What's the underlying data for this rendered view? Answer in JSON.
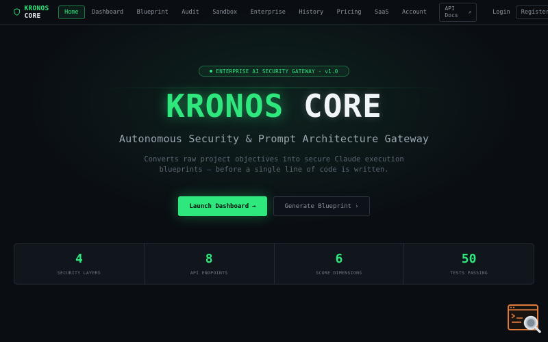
{
  "nav": {
    "brand_part1": "KRONOS",
    "brand_part2": "CORE",
    "brand_icon": "shield-icon",
    "links": [
      {
        "label": "Home",
        "active": true
      },
      {
        "label": "Dashboard"
      },
      {
        "label": "Blueprint"
      },
      {
        "label": "Audit"
      },
      {
        "label": "Sandbox"
      },
      {
        "label": "Enterprise"
      },
      {
        "label": "History"
      },
      {
        "label": "Pricing"
      },
      {
        "label": "SaaS"
      },
      {
        "label": "Account"
      }
    ],
    "api_docs_label": "API Docs",
    "api_docs_icon": "external-link-icon",
    "login_label": "Login",
    "register_label": "Register"
  },
  "hero": {
    "badge": "ENTERPRISE AI SECURITY GATEWAY · v1.0",
    "title_part1": "KRONOS",
    "title_part2": "CORE",
    "subtitle": "Autonomous Security & Prompt Architecture Gateway",
    "description_line1": "Converts raw project objectives into secure Claude execution",
    "description_line2": "blueprints — before a single line of code is written.",
    "primary_button": "Launch Dashboard",
    "primary_button_icon": "arrow-right-icon",
    "secondary_button": "Generate Blueprint",
    "secondary_button_icon": "chevron-right-icon"
  },
  "stats": [
    {
      "value": "4",
      "label": "SECURITY LAYERS"
    },
    {
      "value": "8",
      "label": "API ENDPOINTS"
    },
    {
      "value": "6",
      "label": "SCORE DIMENSIONS"
    },
    {
      "value": "50",
      "label": "TESTS PASSING"
    }
  ],
  "colors": {
    "accent": "#2ee87e",
    "background": "#0a0e13",
    "widget": "#e07b3c"
  }
}
